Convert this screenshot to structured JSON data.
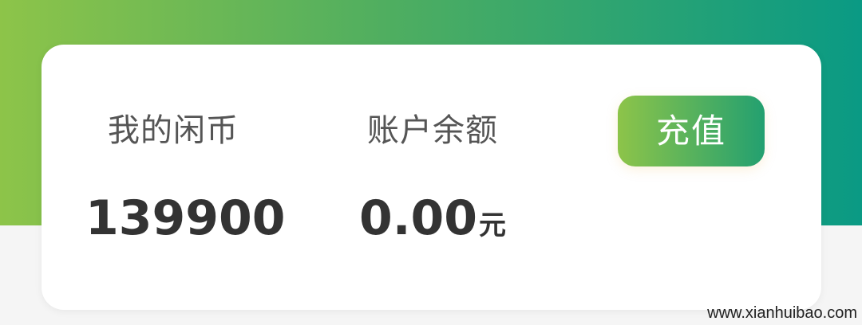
{
  "wallet": {
    "coins_label": "我的闲币",
    "coins_value": "139900",
    "balance_label": "账户余额",
    "balance_value": "0.00",
    "balance_unit": "元",
    "recharge_label": "充值"
  },
  "watermark": "www.xianhuibao.com",
  "colors": {
    "gradient_start": "#8dc449",
    "gradient_end": "#0a9a84"
  }
}
